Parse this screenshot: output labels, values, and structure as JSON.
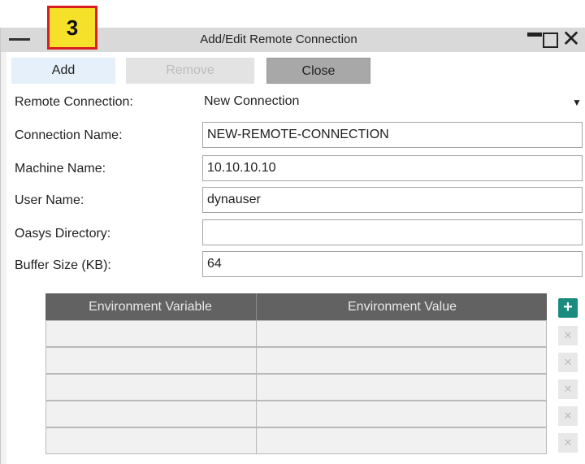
{
  "callout": {
    "number": "3"
  },
  "window": {
    "title": "Add/Edit Remote Connection"
  },
  "toolbar": {
    "add_label": "Add",
    "remove_label": "Remove",
    "close_label": "Close"
  },
  "form": {
    "remote_connection": {
      "label": "Remote Connection:",
      "value": "New Connection"
    },
    "connection_name": {
      "label": "Connection Name:",
      "value": "NEW-REMOTE-CONNECTION"
    },
    "machine_name": {
      "label": "Machine Name:",
      "value": "10.10.10.10"
    },
    "user_name": {
      "label": "User Name:",
      "value": "dynauser"
    },
    "oasys_directory": {
      "label": "Oasys Directory:",
      "value": ""
    },
    "buffer_size": {
      "label": "Buffer Size (KB):",
      "value": "64"
    }
  },
  "env_table": {
    "headers": [
      "Environment Variable",
      "Environment Value"
    ],
    "rows": [
      [
        "",
        ""
      ],
      [
        "",
        ""
      ],
      [
        "",
        ""
      ],
      [
        "",
        ""
      ],
      [
        "",
        ""
      ]
    ]
  },
  "icons": {
    "add_row": "+",
    "delete_row": "✕",
    "dropdown": "▼",
    "close_window": "✕"
  },
  "colors": {
    "callout_fill": "#f5e02a",
    "callout_border": "#d81e1e",
    "header_bg": "#626262",
    "add_icon": "#1b8a7f"
  }
}
